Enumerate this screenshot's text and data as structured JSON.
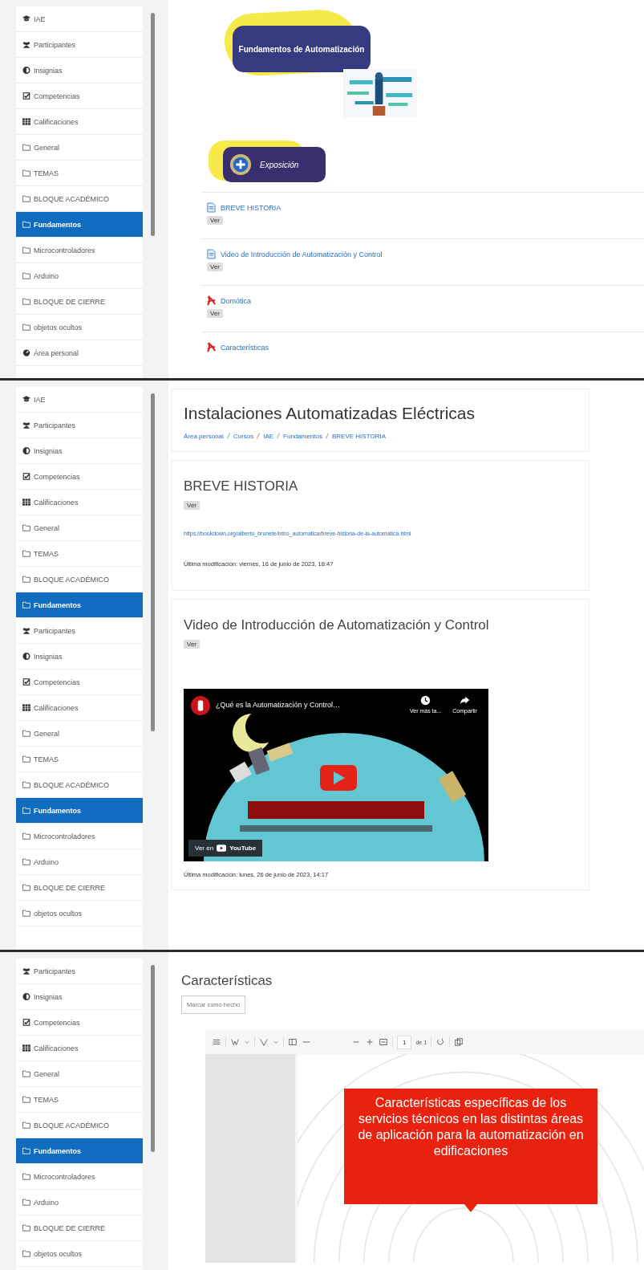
{
  "screens": [
    {
      "kind": "course_page",
      "sidebar": [
        {
          "kind": "cap",
          "label": "IAE",
          "selected": false
        },
        {
          "kind": "users",
          "label": "Participantes",
          "selected": false
        },
        {
          "kind": "gauge",
          "label": "Insignias",
          "selected": false
        },
        {
          "kind": "check",
          "label": "Competencias",
          "selected": false
        },
        {
          "kind": "table",
          "label": "Calificaciones",
          "selected": false
        },
        {
          "kind": "folder",
          "label": "General",
          "selected": false
        },
        {
          "kind": "folder",
          "label": "TEMAS",
          "selected": false
        },
        {
          "kind": "folder",
          "label": "BLOQUE ACADÉMICO",
          "selected": false
        },
        {
          "kind": "folder",
          "label": "Fundamentos",
          "selected": true
        },
        {
          "kind": "folder",
          "label": "Microcontroladores",
          "selected": false
        },
        {
          "kind": "folder",
          "label": "Arduino",
          "selected": false
        },
        {
          "kind": "folder",
          "label": "BLOQUE DE CIERRE",
          "selected": false
        },
        {
          "kind": "folder",
          "label": "objetos ocultos",
          "selected": false
        },
        {
          "kind": "home",
          "label": "Área personal",
          "selected": false
        }
      ],
      "banner": {
        "title": "Fundamentos de Automatización"
      },
      "section_button": "Exposición",
      "activities": [
        {
          "kind": "page",
          "name": "BREVE HISTORIA",
          "button": "Ver"
        },
        {
          "kind": "page",
          "name": "Video de Introducción de Automatización y Control",
          "button": "Ver"
        },
        {
          "kind": "pdf",
          "name": "Domótica",
          "button": "Ver"
        },
        {
          "kind": "pdf",
          "name": "Características"
        }
      ]
    },
    {
      "kind": "resource_pages",
      "sidebar": [
        {
          "kind": "cap",
          "label": "IAE",
          "selected": false
        },
        {
          "kind": "users",
          "label": "Participantes",
          "selected": false
        },
        {
          "kind": "gauge",
          "label": "Insignias",
          "selected": false
        },
        {
          "kind": "check",
          "label": "Competencias",
          "selected": false
        },
        {
          "kind": "table",
          "label": "Calificaciones",
          "selected": false
        },
        {
          "kind": "folder",
          "label": "General",
          "selected": false
        },
        {
          "kind": "folder",
          "label": "TEMAS",
          "selected": false
        },
        {
          "kind": "folder",
          "label": "BLOQUE ACADÉMICO",
          "selected": false
        },
        {
          "kind": "folder",
          "label": "Fundamentos",
          "selected": true
        },
        {
          "kind": "users",
          "label": "Participantes",
          "selected": false
        },
        {
          "kind": "gauge",
          "label": "Insignias",
          "selected": false
        },
        {
          "kind": "check",
          "label": "Competencias",
          "selected": false
        },
        {
          "kind": "table",
          "label": "Calificaciones",
          "selected": false
        },
        {
          "kind": "folder",
          "label": "General",
          "selected": false
        },
        {
          "kind": "folder",
          "label": "TEMAS",
          "selected": false
        },
        {
          "kind": "folder",
          "label": "BLOQUE ACADÉMICO",
          "selected": false
        },
        {
          "kind": "folder",
          "label": "Fundamentos",
          "selected": true
        },
        {
          "kind": "folder",
          "label": "Microcontroladores",
          "selected": false
        },
        {
          "kind": "folder",
          "label": "Arduino",
          "selected": false
        },
        {
          "kind": "folder",
          "label": "BLOQUE DE CIERRE",
          "selected": false
        },
        {
          "kind": "folder",
          "label": "objetos ocultos",
          "selected": false
        }
      ],
      "course_title": "Instalaciones Automatizadas Eléctricas",
      "breadcrumb": [
        "Área personal",
        "Cursos",
        "IAE",
        "Fundamentos",
        "BREVE HISTORIA"
      ],
      "resources": [
        {
          "kind": "url",
          "title": "BREVE HISTORIA",
          "button": "Ver",
          "link": "https://bookdown.org/alberto_brunete/intro_automatica/breve-historia-de-la-automatica.html",
          "modified": "Última modificación: viernes, 16 de junio de 2023, 18:47"
        },
        {
          "kind": "video",
          "title": "Video de Introducción de Automatización y Control",
          "button": "Ver",
          "video": {
            "title": "¿Qué es la Automatización y Control…",
            "watch_later": "Ver más ta...",
            "share": "Compartir",
            "watch_on": "Ver en",
            "brand": "YouTube"
          },
          "modified": "Última modificación: lunes, 26 de junio de 2023, 14:17"
        }
      ]
    },
    {
      "kind": "pdf_page",
      "sidebar": [
        {
          "kind": "users",
          "label": "Participantes",
          "selected": false
        },
        {
          "kind": "gauge",
          "label": "Insignias",
          "selected": false
        },
        {
          "kind": "check",
          "label": "Competencias",
          "selected": false
        },
        {
          "kind": "table",
          "label": "Calificaciones",
          "selected": false
        },
        {
          "kind": "folder",
          "label": "General",
          "selected": false
        },
        {
          "kind": "folder",
          "label": "TEMAS",
          "selected": false
        },
        {
          "kind": "folder",
          "label": "BLOQUE ACADÉMICO",
          "selected": false
        },
        {
          "kind": "folder",
          "label": "Fundamentos",
          "selected": true
        },
        {
          "kind": "folder",
          "label": "Microcontroladores",
          "selected": false
        },
        {
          "kind": "folder",
          "label": "Arduino",
          "selected": false
        },
        {
          "kind": "folder",
          "label": "BLOQUE DE CIERRE",
          "selected": false
        },
        {
          "kind": "folder",
          "label": "objetos ocultos",
          "selected": false
        }
      ],
      "title": "Características",
      "done_button": "Marcar como hecho",
      "viewer": {
        "page": "1",
        "page_count": "de 1",
        "slide_text": "Características específicas de los servicios técnicos en las distintas áreas de aplicación para la automatización en edificaciones"
      }
    }
  ]
}
